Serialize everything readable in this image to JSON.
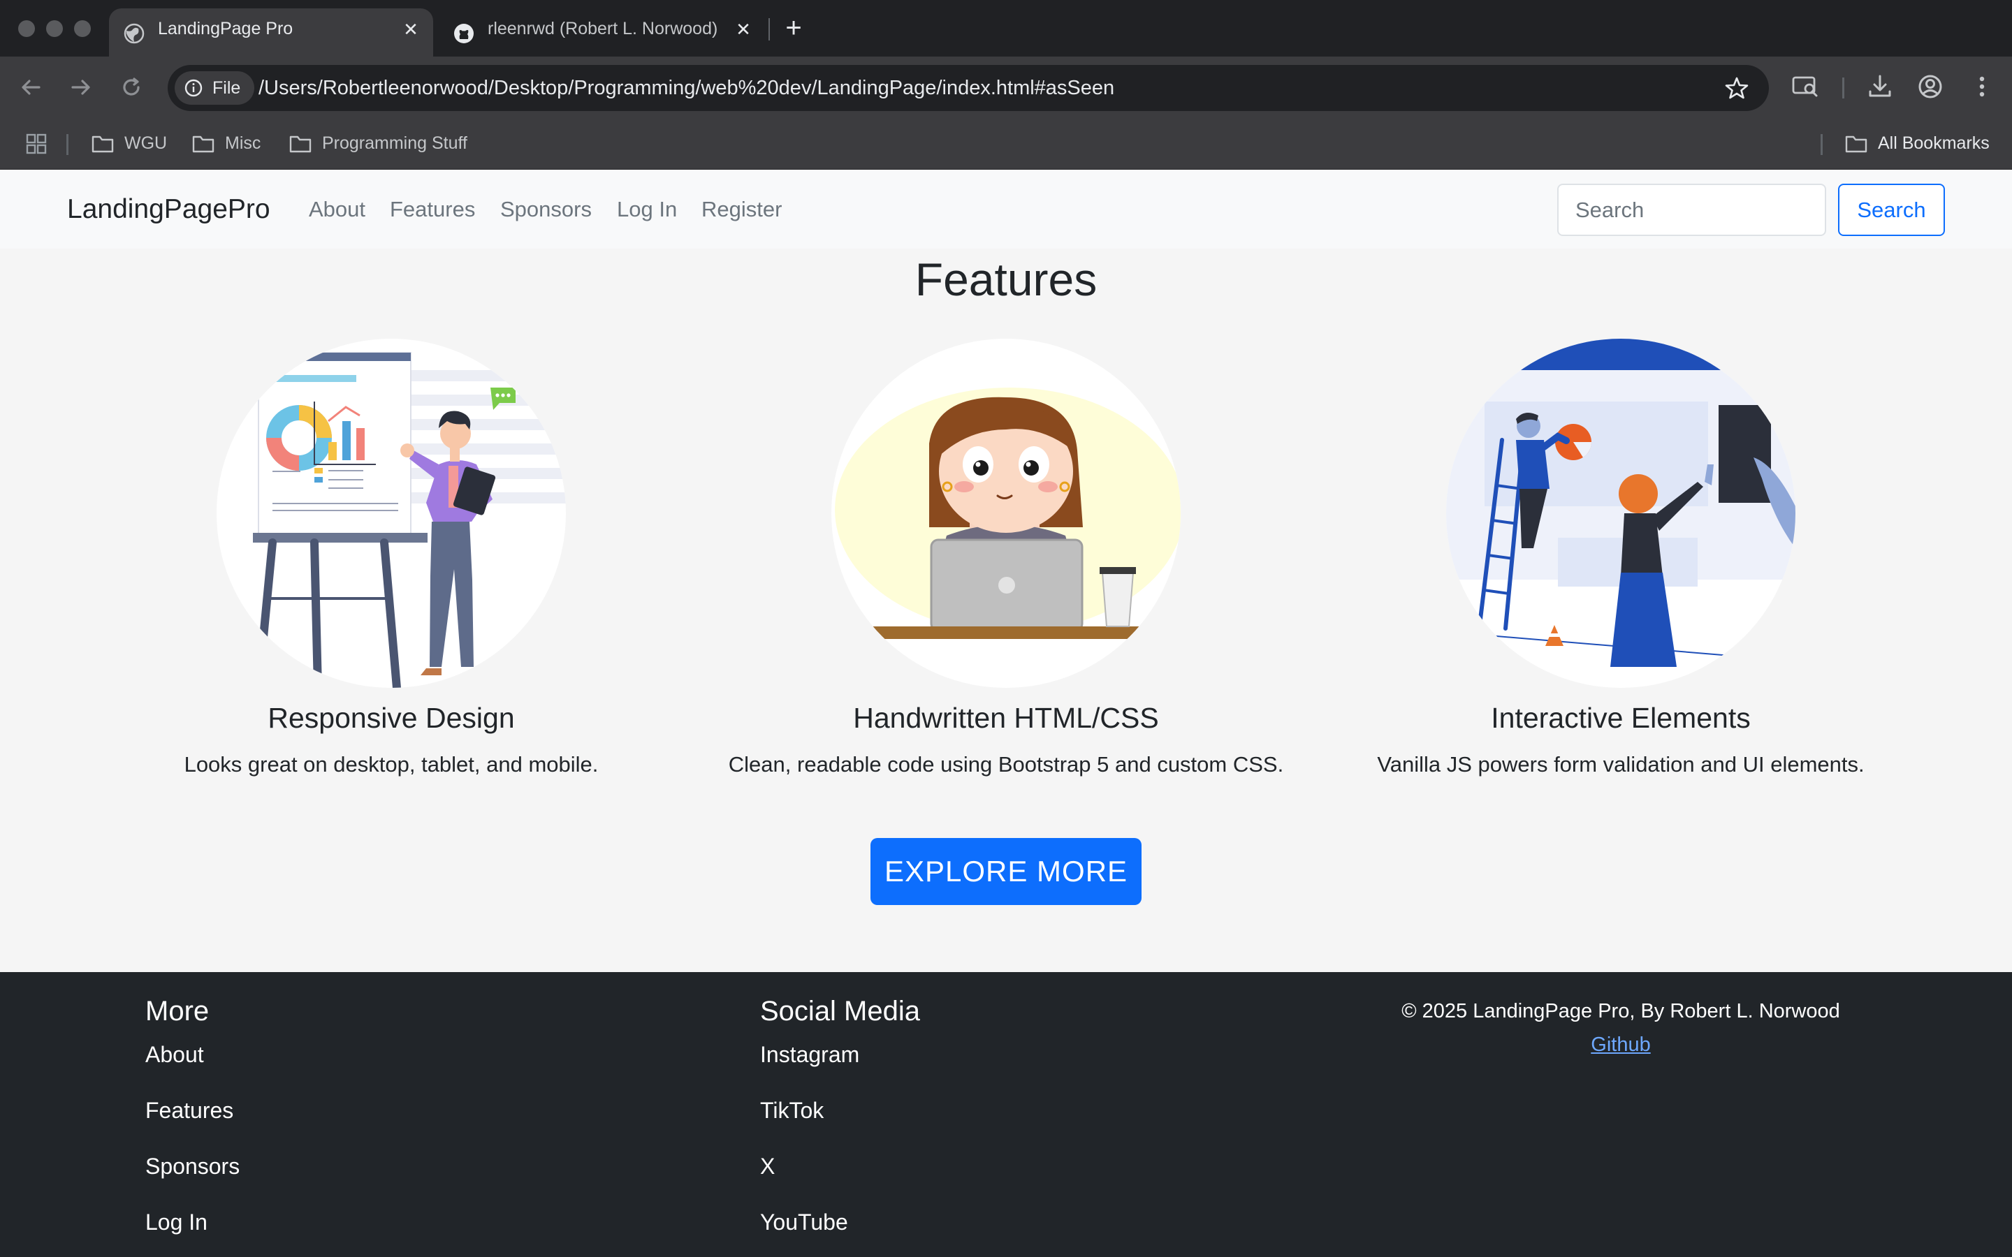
{
  "browser": {
    "tabs": [
      {
        "title": "LandingPage Pro",
        "icon": "globe-icon",
        "active": true
      },
      {
        "title": "rleenrwd (Robert L. Norwood)",
        "icon": "github-icon",
        "active": false
      }
    ],
    "url_chip": "File",
    "url": "/Users/Robertleenorwood/Desktop/Programming/web%20dev/LandingPage/index.html#asSeen",
    "bookmarks": [
      "WGU",
      "Misc",
      "Programming Stuff"
    ],
    "all_bookmarks": "All Bookmarks"
  },
  "navbar": {
    "brand": "LandingPagePro",
    "links": [
      "About",
      "Features",
      "Sponsors",
      "Log In",
      "Register"
    ],
    "search_placeholder": "Search",
    "search_button": "Search",
    "accent": "#0d6efd"
  },
  "features": {
    "heading": "Features",
    "items": [
      {
        "title": "Responsive Design",
        "description": "Looks great on desktop, tablet, and mobile."
      },
      {
        "title": "Handwritten HTML/CSS",
        "description": "Clean, readable code using Bootstrap 5 and custom CSS."
      },
      {
        "title": "Interactive Elements",
        "description": "Vanilla JS powers form validation and UI elements."
      }
    ],
    "cta": "EXPLORE MORE"
  },
  "footer": {
    "more_heading": "More",
    "more_links": [
      "About",
      "Features",
      "Sponsors",
      "Log In"
    ],
    "social_heading": "Social Media",
    "social_links": [
      "Instagram",
      "TikTok",
      "X",
      "YouTube"
    ],
    "copyright": "© 2025 LandingPage Pro, By Robert L. Norwood",
    "github_link": "Github",
    "background": "#212529"
  }
}
